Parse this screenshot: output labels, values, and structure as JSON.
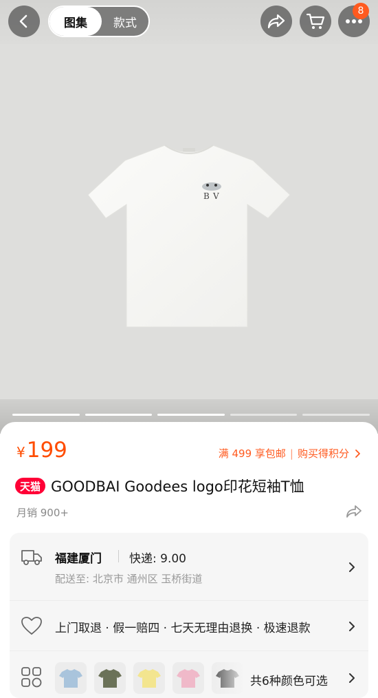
{
  "header": {
    "tabs": [
      {
        "label": "图集",
        "active": true
      },
      {
        "label": "款式",
        "active": false
      }
    ],
    "cart_badge": "8",
    "icons": [
      "back-icon",
      "share-icon",
      "cart-icon",
      "more-icon"
    ]
  },
  "gallery": {
    "indicator_count": 5,
    "active_indicator": 0
  },
  "product": {
    "currency": "¥",
    "price": "199",
    "promo_shipping": "满 499 享包邮",
    "promo_points": "购买得积分",
    "store_badge": "天猫",
    "title": "GOODBAI Goodees logo印花短袖T恤",
    "sales": "月销 900+"
  },
  "shipping": {
    "origin": "福建厦门",
    "fee": "快递: 9.00",
    "destination": "配送至: 北京市 通州区 玉桥街道"
  },
  "service": {
    "guarantee": "上门取退 · 假一赔四 · 七天无理由退换 · 极速退款"
  },
  "variants": {
    "swatch_colors": [
      "#a9c4dc",
      "#6b7258",
      "#f3e58f",
      "#f0b9c9",
      "#3c3c3c"
    ],
    "summary": "共6种颜色可选"
  },
  "colors": {
    "accent": "#ff4c00",
    "tmall_red": "#ff0036",
    "badge_orange": "#ff5a1f"
  }
}
